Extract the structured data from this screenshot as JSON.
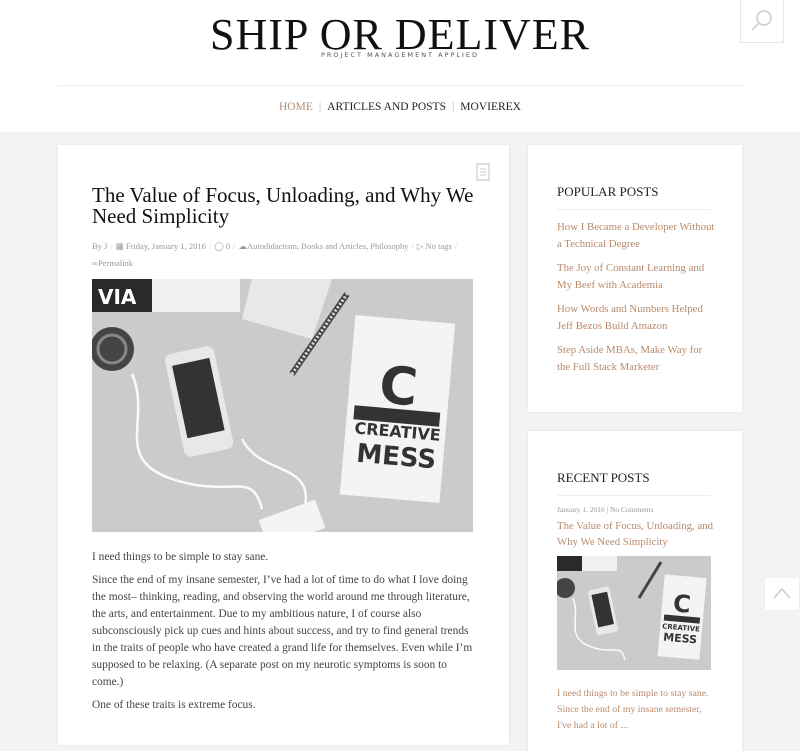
{
  "site": {
    "title": "SHIP OR DELIVER",
    "tagline": "PROJECT MANAGEMENT APPLIED"
  },
  "nav": {
    "items": [
      {
        "label": "HOME",
        "active": true
      },
      {
        "label": "ARTICLES AND POSTS",
        "active": false
      },
      {
        "label": "MOVIEREX",
        "active": false
      }
    ]
  },
  "post": {
    "title": "The Value of Focus, Unloading, and Why We Need Simplicity",
    "author": "By J",
    "date": "Friday, January 1, 2016",
    "comments": "0",
    "categories": "Autodidactism, Books and Articles, Philosophy",
    "tags": "No tags",
    "permalink": "Permalink",
    "notebook_letter": "C",
    "notebook_text_1": "CREATIVE",
    "notebook_text_2": "MESS",
    "paper_text": "VIA",
    "paragraphs": [
      "I need things to be simple to stay sane.",
      "Since the end of my insane semester, I’ve had a lot of time to do what I love doing the most– thinking, reading, and observing the world around me through literature, the arts, and entertainment. Due to my ambitious nature, I of course also subconsciously pick up cues and hints about success, and try to find general trends in the traits of people who have created a grand life for themselves. Even while I’m supposed to be relaxing. (A separate post on my neurotic symptoms is soon to come.)",
      "One of these traits is extreme focus."
    ]
  },
  "popular": {
    "title": "POPULAR POSTS",
    "items": [
      "How I Became a Developer Without a Technical Degree",
      "The Joy of Constant Learning and My Beef with Academia",
      "How Words and Numbers Helped Jeff Bezos Build Amazon",
      "Step Aside MBAs, Make Way for the Full Stack Marketer"
    ]
  },
  "recent": {
    "title": "RECENT POSTS",
    "date": "January 1, 2016",
    "comments": "No Comments",
    "post_title": "The Value of Focus, Unloading, and Why We Need Simplicity",
    "excerpt": "I need things to be simple to stay sane. Since the end of my insane semester, I've had a lot of ..."
  },
  "colors": {
    "accent": "#b88a6c",
    "background": "#f3f3f3"
  },
  "icons": [
    "search-icon",
    "post-format-icon",
    "calendar-icon",
    "comment-icon",
    "folder-icon",
    "tag-icon",
    "link-icon",
    "arrow-up-icon"
  ]
}
